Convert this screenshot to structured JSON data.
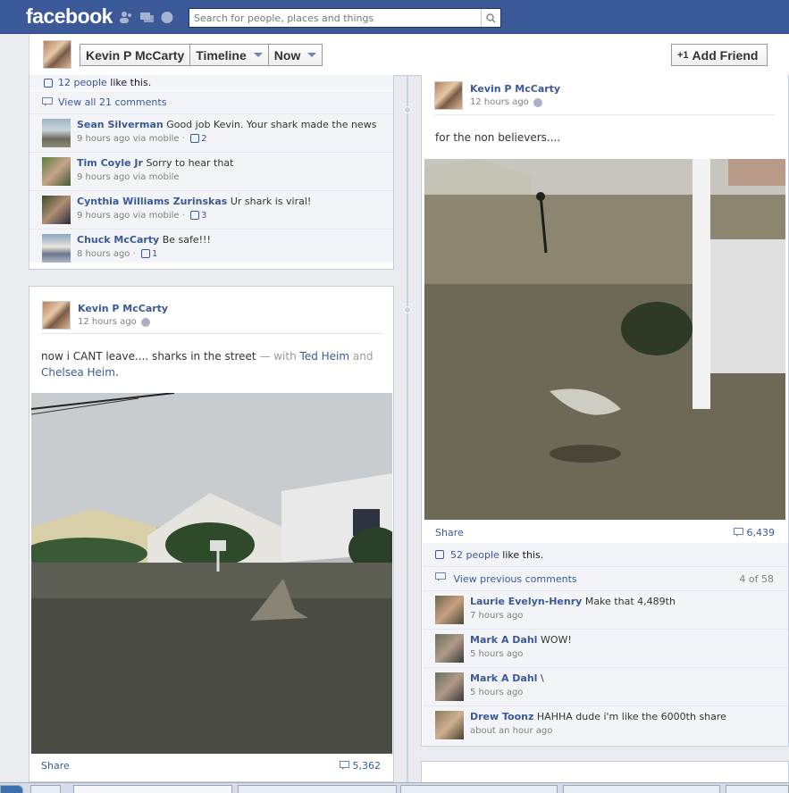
{
  "topbar": {
    "logo": "facebook",
    "search_placeholder": "Search for people, places and things"
  },
  "header": {
    "name_button": "Kevin P McCarty",
    "timeline_button": "Timeline",
    "now_button": "Now",
    "add_friend_button": "Add Friend"
  },
  "left_top": {
    "likes_count": "12 people",
    "likes_suffix": "like this.",
    "view_comments": "View all 21 comments",
    "comments": [
      {
        "name": "Sean Silverman",
        "text": "Good job Kevin. Your shark made the news",
        "meta": "9 hours ago via mobile",
        "likes": "2"
      },
      {
        "name": "Tim Coyle Jr",
        "text": "Sorry to hear that",
        "meta": "9 hours ago via mobile",
        "likes": ""
      },
      {
        "name": "Cynthia Williams Zurinskas",
        "text": "Ur shark is viral!",
        "meta": "9 hours ago via mobile",
        "likes": "3"
      },
      {
        "name": "Chuck McCarty",
        "text": "Be safe!!!",
        "meta": "8 hours ago",
        "likes": "1"
      }
    ]
  },
  "left_post": {
    "author": "Kevin P McCarty",
    "time": "12 hours ago",
    "text": "now i CANT leave.... sharks in the street",
    "with": "— with",
    "tag1": "Ted Heim",
    "and": "and",
    "tag2": "Chelsea Heim",
    "share": "Share",
    "share_count": "5,362"
  },
  "right_post": {
    "author": "Kevin P McCarty",
    "time": "12 hours ago",
    "text": "for the non believers....",
    "share": "Share",
    "share_count": "6,439",
    "likes_count": "52 people",
    "likes_suffix": "like this.",
    "view_previous": "View previous comments",
    "pager": "4 of 58",
    "comments": [
      {
        "name": "Laurie Evelyn-Henry",
        "text": "Make that 4,489th",
        "meta": "7 hours ago"
      },
      {
        "name": "Mark A Dahl",
        "text": "WOW!",
        "meta": "5 hours ago"
      },
      {
        "name": "Mark A Dahl",
        "text": "\\",
        "meta": "5 hours ago"
      },
      {
        "name": "Drew Toonz",
        "text": "HAHHA dude i'm like the 6000th share",
        "meta": "about an hour ago"
      }
    ]
  }
}
